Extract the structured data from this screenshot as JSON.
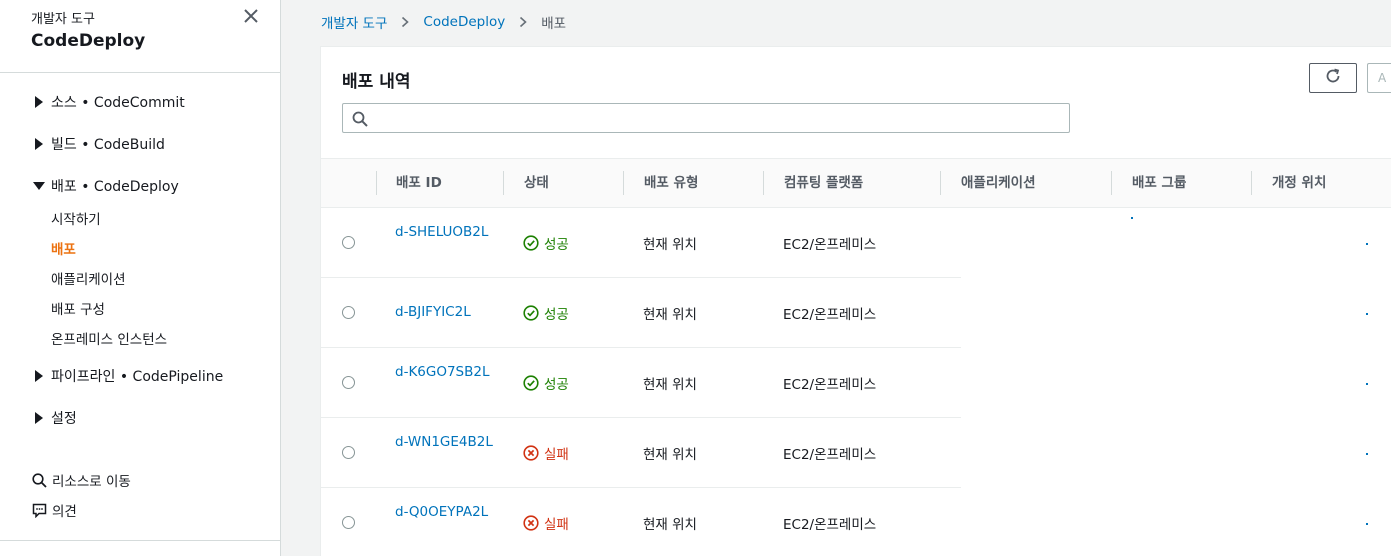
{
  "sidebar": {
    "subtitle": "개발자 도구",
    "title": "CodeDeploy",
    "groups": [
      {
        "label": "소스 • CodeCommit",
        "expanded": false
      },
      {
        "label": "빌드 • CodeBuild",
        "expanded": false
      },
      {
        "label": "배포 • CodeDeploy",
        "expanded": true
      },
      {
        "label": "파이프라인 • CodePipeline",
        "expanded": false
      },
      {
        "label": "설정",
        "expanded": false
      }
    ],
    "deploy_links": [
      "시작하기",
      "배포",
      "애플리케이션",
      "배포 구성",
      "온프레미스 인스턴스"
    ],
    "active_link": "배포",
    "tools": {
      "goto_resource": "리소스로 이동",
      "feedback": "의견"
    }
  },
  "breadcrumb": {
    "items": [
      "개발자 도구",
      "CodeDeploy"
    ],
    "current": "배포"
  },
  "panel": {
    "title": "배포 내역",
    "next_button_label": "A",
    "search": {
      "value": "",
      "placeholder": ""
    }
  },
  "table": {
    "columns": [
      "배포 ID",
      "상태",
      "배포 유형",
      "컴퓨팅 플랫폼",
      "애플리케이션",
      "배포 그룹",
      "개정 위치"
    ],
    "rows": [
      {
        "id": "d-SHELUOB2L",
        "status": "성공",
        "status_kind": "success",
        "type": "현재 위치",
        "platform": "EC2/온프레미스"
      },
      {
        "id": "d-BJIFYIC2L",
        "status": "성공",
        "status_kind": "success",
        "type": "현재 위치",
        "platform": "EC2/온프레미스"
      },
      {
        "id": "d-K6GO7SB2L",
        "status": "성공",
        "status_kind": "success",
        "type": "현재 위치",
        "platform": "EC2/온프레미스"
      },
      {
        "id": "d-WN1GE4B2L",
        "status": "실패",
        "status_kind": "failure",
        "type": "현재 위치",
        "platform": "EC2/온프레미스"
      },
      {
        "id": "d-Q0OEYPA2L",
        "status": "실패",
        "status_kind": "failure",
        "type": "현재 위치",
        "platform": "EC2/온프레미스"
      }
    ]
  },
  "colors": {
    "link": "#0073bb",
    "active_nav": "#ec7211",
    "success": "#1d8102",
    "failure": "#d13212"
  },
  "icons": {
    "close": "close-icon",
    "caret_right": "caret-right-icon",
    "caret_down": "caret-down-icon",
    "search": "search-icon",
    "feedback": "feedback-icon",
    "refresh": "refresh-icon",
    "chevron": "chevron-right-icon",
    "success": "check-circle-icon",
    "failure": "x-circle-icon"
  }
}
